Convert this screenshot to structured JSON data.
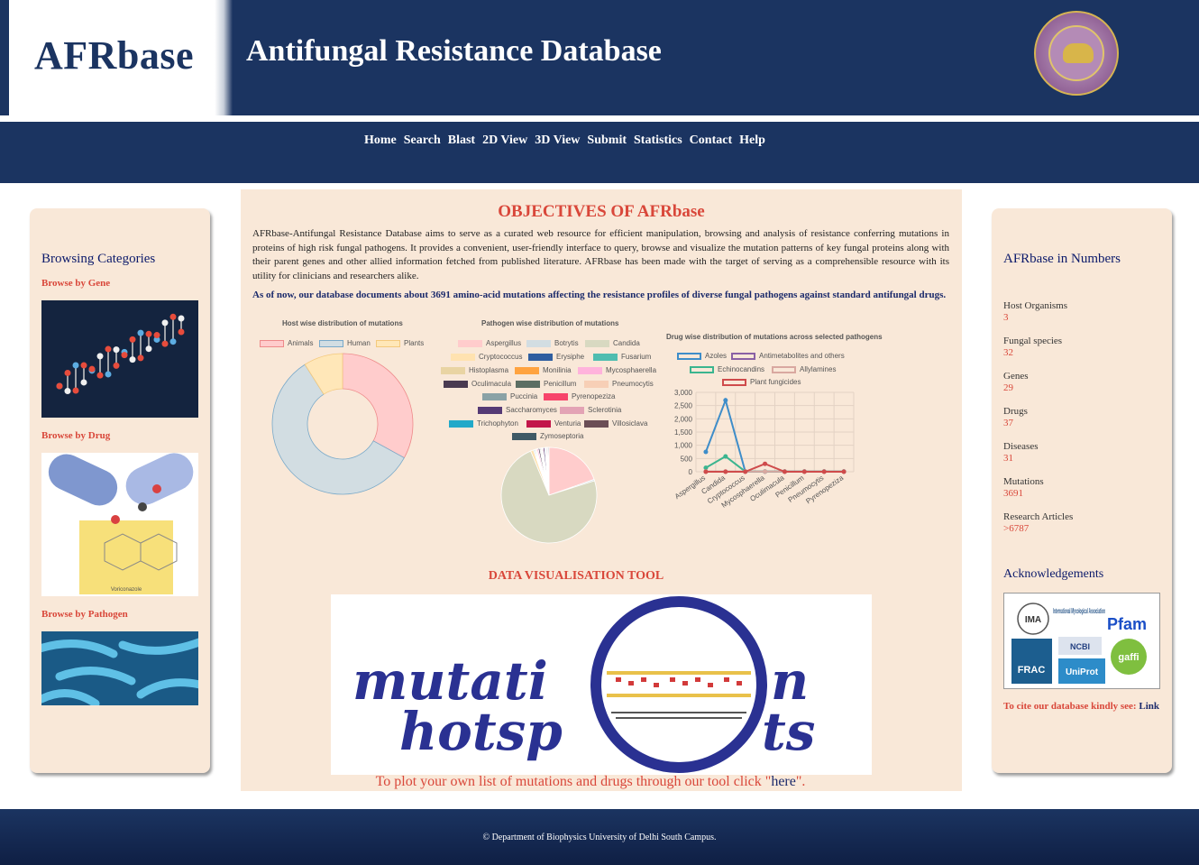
{
  "header": {
    "logo": "AFRbase",
    "title": "Antifungal Resistance Database",
    "seal_icon": "university-seal-icon"
  },
  "nav": {
    "items": [
      "Home",
      "Search",
      "Blast",
      "2D View",
      "3D View",
      "Submit",
      "Statistics",
      "Contact",
      "Help"
    ]
  },
  "left_panel": {
    "heading": "Browsing Categories",
    "gene_label": "Browse by Gene",
    "drug_label": "Browse by Drug",
    "drug_caption": "Voriconazole",
    "pathogen_label": "Browse by Pathogen"
  },
  "main": {
    "title": "OBJECTIVES OF AFRbase",
    "description": "AFRbase-Antifungal Resistance Database aims to serve as a curated web resource for efficient manipulation, browsing and analysis of resistance conferring mutations in proteins of high risk fungal pathogens. It provides a convenient, user-friendly interface to query, browse and visualize the mutation patterns of key fungal proteins along with their parent genes and other allied information fetched from published literature. AFRbase has been made with the target of serving as a comprehensible resource with its utility for clinicians and researchers alike.",
    "highlight": "As of now, our database documents about 3691 amino-acid mutations affecting the resistance profiles of diverse fungal pathogens against standard antifungal drugs.",
    "dv_title": "DATA VISUALISATION TOOL",
    "viz_word_1": "mutati",
    "viz_word_2": "n",
    "viz_word_3": "hotsp",
    "viz_word_4": "ts",
    "plot_prefix": "To plot your own list of mutations and drugs through our tool click \"",
    "plot_link": "here",
    "plot_suffix": "\"."
  },
  "chart_data": [
    {
      "type": "pie",
      "title": "Host wise distribution of mutations",
      "categories": [
        "Animals",
        "Human",
        "Plants"
      ],
      "values": [
        33,
        58,
        9
      ],
      "colors": [
        "#ffcccc",
        "#d2dde2",
        "#ffe7b8"
      ],
      "borders": [
        "#ee8a8a",
        "#79a9c9",
        "#f4c97d"
      ],
      "legend": "top"
    },
    {
      "type": "pie",
      "title": "Pathogen wise distribution of mutations",
      "categories": [
        "Aspergillus",
        "Botrytis",
        "Candida",
        "Cryptococcus",
        "Erysiphe",
        "Fusarium",
        "Histoplasma",
        "Monilinia",
        "Mycosphaerella",
        "Oculimacula",
        "Penicillum",
        "Pneumocytis",
        "Puccinia",
        "Pyrenopeziza",
        "Saccharomyces",
        "Sclerotinia",
        "Trichophyton",
        "Venturia",
        "Villosiclava",
        "Zymoseptoria"
      ],
      "values": [
        20,
        0.5,
        75,
        1,
        0.3,
        0.3,
        0.3,
        0.3,
        0.5,
        0.5,
        0.3,
        0.3,
        0.3,
        0.3,
        0.5,
        0.3,
        0.3,
        0.3,
        0.3,
        0.3
      ],
      "colors": [
        "#ffcccc",
        "#d2dde2",
        "#d8d9c1",
        "#ffe2b0",
        "#2f5ea0",
        "#4fbdb0",
        "#e9d4a3",
        "#ffa340",
        "#ffb3dc",
        "#4a3a50",
        "#5c6e63",
        "#f7cfb6",
        "#8aa2a6",
        "#f7446a",
        "#553a75",
        "#e3a3b5",
        "#22a9c9",
        "#c2164a",
        "#6b4e56",
        "#3f5a66"
      ],
      "legend": "top"
    },
    {
      "type": "line",
      "title": "Drug wise distribution of mutations across selected pathogens",
      "categories": [
        "Aspergillus",
        "Candida",
        "Cryptococcus",
        "Mycosphaerella",
        "Oculimacula",
        "Penicillum",
        "Pneumocytis",
        "Pyrenopeziza"
      ],
      "series": [
        {
          "name": "Azoles",
          "values": [
            750,
            2700,
            10,
            10,
            10,
            10,
            10,
            10
          ],
          "color": "#3e8dc9"
        },
        {
          "name": "Antimetabolites and others",
          "values": [
            5,
            5,
            5,
            5,
            5,
            5,
            5,
            5
          ],
          "color": "#8a60a5"
        },
        {
          "name": "Echinocandins",
          "values": [
            150,
            580,
            10,
            10,
            10,
            10,
            10,
            10
          ],
          "color": "#3bb58f"
        },
        {
          "name": "Allylamines",
          "values": [
            10,
            10,
            10,
            10,
            10,
            10,
            10,
            10
          ],
          "color": "#d9a8a0"
        },
        {
          "name": "Plant fungicides",
          "values": [
            0,
            0,
            0,
            300,
            0,
            0,
            0,
            0
          ],
          "color": "#cf4b4b"
        }
      ],
      "yticks": [
        "0",
        "500",
        "1,000",
        "1,500",
        "2,000",
        "2,500",
        "3,000"
      ],
      "ylim": [
        0,
        3000
      ],
      "legend": "top"
    }
  ],
  "right_panel": {
    "heading": "AFRbase in Numbers",
    "stats": [
      {
        "label": "Host Organisms",
        "value": "3"
      },
      {
        "label": "Fungal species",
        "value": "32"
      },
      {
        "label": "Genes",
        "value": "29"
      },
      {
        "label": "Drugs",
        "value": "37"
      },
      {
        "label": "Diseases",
        "value": "31"
      },
      {
        "label": "Mutations",
        "value": "3691"
      },
      {
        "label": "Research Articles",
        "value": ">6787"
      }
    ],
    "ack_heading": "Acknowledgements",
    "ack_logos": [
      "IMA",
      "International Mycological Association",
      "Pfam",
      "NCBI",
      "FRAC",
      "UniProt",
      "gaffi"
    ],
    "cite_text": "To cite our database kindly see:",
    "cite_link": "Link"
  },
  "footer": {
    "text": "© Department of Biophysics University of Delhi South Campus."
  }
}
